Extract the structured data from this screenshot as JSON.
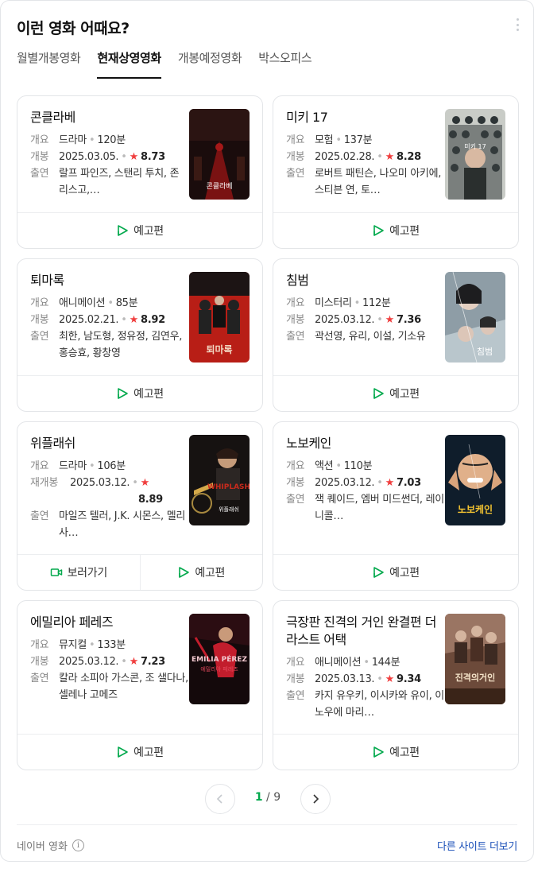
{
  "header": {
    "title": "이런 영화 어때요?"
  },
  "tabs": [
    {
      "label": "월별개봉영화",
      "active": false
    },
    {
      "label": "현재상영영화",
      "active": true
    },
    {
      "label": "개봉예정영화",
      "active": false
    },
    {
      "label": "박스오피스",
      "active": false
    }
  ],
  "labels": {
    "overview": "개요",
    "release": "개봉",
    "rerelease": "재개봉",
    "cast": "출연",
    "trailer": "예고편",
    "watch": "보러가기"
  },
  "movies": [
    {
      "title": "콘클라베",
      "genre": "드라마",
      "runtime": "120분",
      "date": "2025.03.05.",
      "rating": "8.73",
      "cast": "랄프 파인즈, 스탠리 투치, 존 리스고,…"
    },
    {
      "title": "미키 17",
      "genre": "모험",
      "runtime": "137분",
      "date": "2025.02.28.",
      "rating": "8.28",
      "cast": "로버트 패틴슨, 나오미 아키에, 스티븐 연, 토…"
    },
    {
      "title": "퇴마록",
      "genre": "애니메이션",
      "runtime": "85분",
      "date": "2025.02.21.",
      "rating": "8.92",
      "cast": "최한, 남도형, 정유정, 김연우, 홍승효, 황창영"
    },
    {
      "title": "침범",
      "genre": "미스터리",
      "runtime": "112분",
      "date": "2025.03.12.",
      "rating": "7.36",
      "cast": "곽선영, 유리, 이설, 기소유"
    },
    {
      "title": "위플래쉬",
      "genre": "드라마",
      "runtime": "106분",
      "date": "2025.03.12.",
      "rating": "8.89",
      "cast": "마일즈 텔러, J.K. 시몬스, 멜리사…"
    },
    {
      "title": "노보케인",
      "genre": "액션",
      "runtime": "110분",
      "date": "2025.03.12.",
      "rating": "7.03",
      "cast": "잭 퀘이드, 엠버 미드썬더, 레이 니콜…"
    },
    {
      "title": "에밀리아 페레즈",
      "genre": "뮤지컬",
      "runtime": "133분",
      "date": "2025.03.12.",
      "rating": "7.23",
      "cast": "칼라 소피아 가스콘, 조 샐다나, 셀레나 고메즈"
    },
    {
      "title": "극장판 진격의 거인 완결편 더 라스트 어택",
      "genre": "애니메이션",
      "runtime": "144분",
      "date": "2025.03.13.",
      "rating": "9.34",
      "cast": "카지 유우키, 이시카와 유이, 이노우에 마리…"
    }
  ],
  "pagination": {
    "current": "1",
    "separator": "/",
    "total": "9"
  },
  "footer": {
    "source": "네이버 영화",
    "more": "다른 사이트 더보기"
  },
  "colors": {
    "accent": "#03a94d",
    "star": "#f03e3e",
    "link": "#1a4fb8"
  }
}
